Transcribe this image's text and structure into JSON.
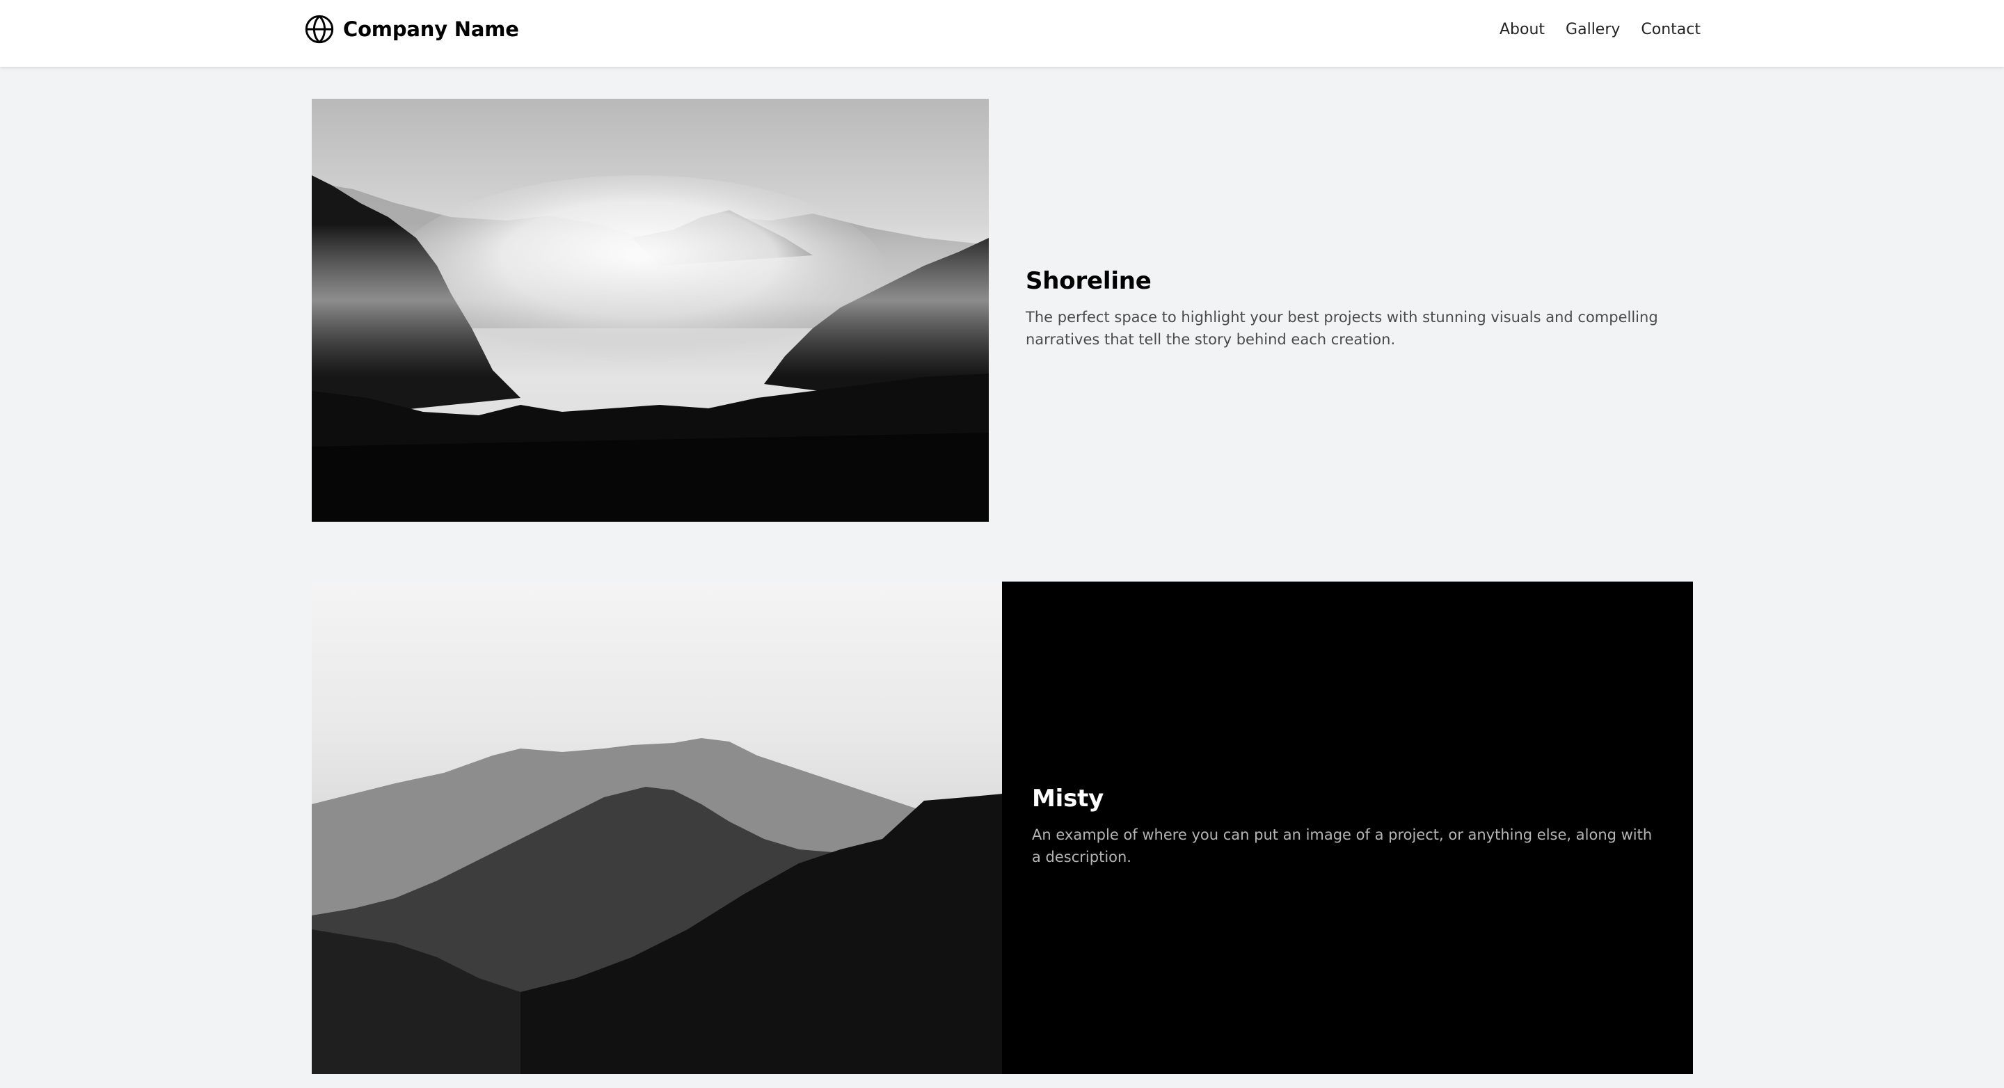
{
  "navbar": {
    "brand": "Company Name",
    "brand_icon": "globe-icon",
    "links": [
      "About",
      "Gallery",
      "Contact"
    ]
  },
  "sections": [
    {
      "image": "foggy-mountain-forest-photo",
      "title": "Shoreline",
      "description": "The perfect space to highlight your best projects with stunning visuals and compelling narratives that tell the story behind each creation."
    },
    {
      "image": "layered-mountain-ridges-photo",
      "title": "Misty",
      "description": "An example of where you can put an image of a project, or anything else, along with a description."
    }
  ],
  "colors": {
    "page_background": "#f2f3f5",
    "navbar_background": "#ffffff",
    "panel_dark": "#000000"
  }
}
